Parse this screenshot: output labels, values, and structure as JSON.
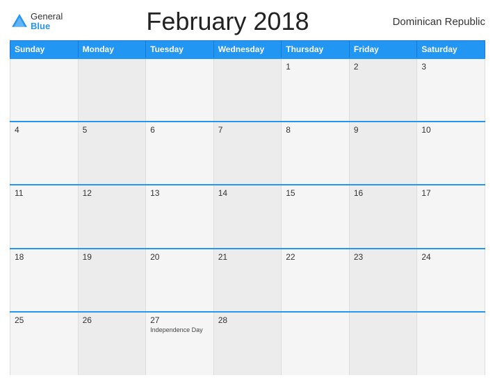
{
  "header": {
    "logo": {
      "general": "General",
      "blue": "Blue"
    },
    "title": "February 2018",
    "country": "Dominican Republic"
  },
  "calendar": {
    "days_of_week": [
      "Sunday",
      "Monday",
      "Tuesday",
      "Wednesday",
      "Thursday",
      "Friday",
      "Saturday"
    ],
    "weeks": [
      [
        {
          "day": "",
          "holiday": ""
        },
        {
          "day": "",
          "holiday": ""
        },
        {
          "day": "",
          "holiday": ""
        },
        {
          "day": "",
          "holiday": ""
        },
        {
          "day": "1",
          "holiday": ""
        },
        {
          "day": "2",
          "holiday": ""
        },
        {
          "day": "3",
          "holiday": ""
        }
      ],
      [
        {
          "day": "4",
          "holiday": ""
        },
        {
          "day": "5",
          "holiday": ""
        },
        {
          "day": "6",
          "holiday": ""
        },
        {
          "day": "7",
          "holiday": ""
        },
        {
          "day": "8",
          "holiday": ""
        },
        {
          "day": "9",
          "holiday": ""
        },
        {
          "day": "10",
          "holiday": ""
        }
      ],
      [
        {
          "day": "11",
          "holiday": ""
        },
        {
          "day": "12",
          "holiday": ""
        },
        {
          "day": "13",
          "holiday": ""
        },
        {
          "day": "14",
          "holiday": ""
        },
        {
          "day": "15",
          "holiday": ""
        },
        {
          "day": "16",
          "holiday": ""
        },
        {
          "day": "17",
          "holiday": ""
        }
      ],
      [
        {
          "day": "18",
          "holiday": ""
        },
        {
          "day": "19",
          "holiday": ""
        },
        {
          "day": "20",
          "holiday": ""
        },
        {
          "day": "21",
          "holiday": ""
        },
        {
          "day": "22",
          "holiday": ""
        },
        {
          "day": "23",
          "holiday": ""
        },
        {
          "day": "24",
          "holiday": ""
        }
      ],
      [
        {
          "day": "25",
          "holiday": ""
        },
        {
          "day": "26",
          "holiday": ""
        },
        {
          "day": "27",
          "holiday": "Independence Day"
        },
        {
          "day": "28",
          "holiday": ""
        },
        {
          "day": "",
          "holiday": ""
        },
        {
          "day": "",
          "holiday": ""
        },
        {
          "day": "",
          "holiday": ""
        }
      ]
    ]
  }
}
